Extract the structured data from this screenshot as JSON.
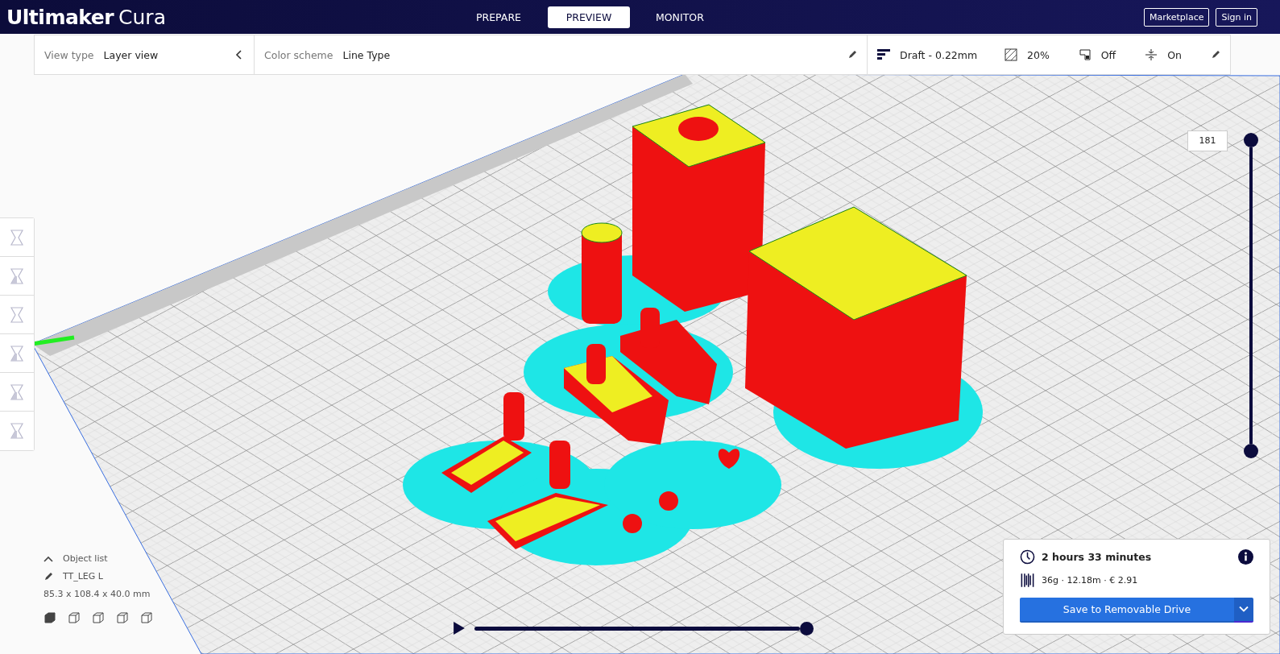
{
  "header": {
    "logo": "Ultimaker",
    "product": "Cura",
    "tabs": [
      {
        "label": "PREPARE",
        "selected": false
      },
      {
        "label": "PREVIEW",
        "selected": true
      },
      {
        "label": "MONITOR",
        "selected": false
      }
    ],
    "buttons": [
      "Marketplace",
      "Sign in"
    ]
  },
  "view_bar": {
    "view_type_label": "View type",
    "view_type": "Layer view",
    "color_scheme_label": "Color scheme",
    "color_scheme": "Line Type"
  },
  "print_setup": {
    "profile": "Draft - 0.22mm",
    "infill": "20%",
    "support": "Off",
    "adhesion": "On"
  },
  "object_list": {
    "label": "Object list",
    "object_name": "TT_LEG L",
    "dimensions": "85.3 x 108.4 x 40.0 mm"
  },
  "layer_slider": {
    "value": "181",
    "level": 1
  },
  "path_slider": {
    "level": 1
  },
  "print_info": {
    "time": "2 hours 33 minutes",
    "material": "36g · 12.18m · € 2.91",
    "save_button": "Save to Removable Drive"
  }
}
